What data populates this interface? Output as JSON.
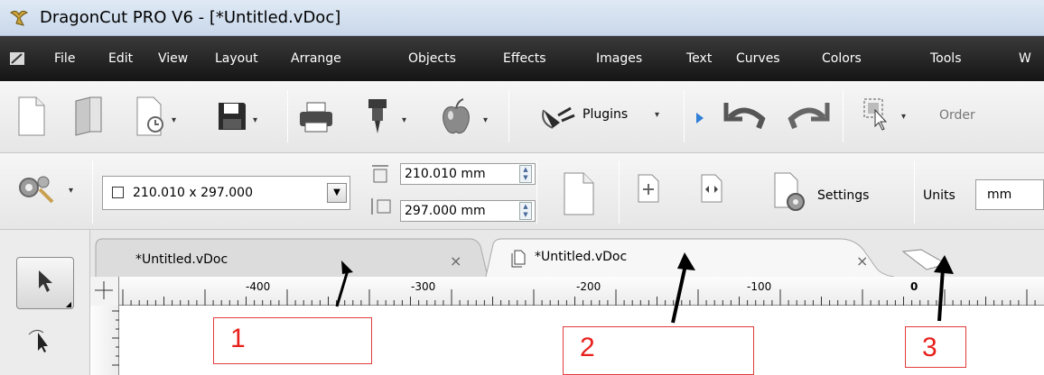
{
  "window": {
    "title": "DragonCut PRO V6 - [*Untitled.vDoc]",
    "app_icon": "dragon-app-icon"
  },
  "menu": {
    "items": [
      "File",
      "Edit",
      "View",
      "Layout",
      "Arrange",
      "Objects",
      "Effects",
      "Images",
      "Text",
      "Curves",
      "Colors",
      "Tools",
      "W"
    ]
  },
  "toolbar_main": {
    "icons": [
      "new-document-icon",
      "open-folder-icon",
      "recent-files-icon",
      "save-icon",
      "print-icon",
      "cutter-icon",
      "apple-icon",
      "plugins-icon",
      "play-icon",
      "undo-icon",
      "redo-icon",
      "select-tool-icon"
    ],
    "plugins_label": "Plugins",
    "order_label": "Order"
  },
  "toolbar_page": {
    "page_size": "210.010 x 297.000",
    "width_value": "210.010 mm",
    "height_value": "297.000 mm",
    "settings_label": "Settings",
    "units_label": "Units",
    "units_value": "mm"
  },
  "tabs": [
    {
      "label": "*Untitled.vDoc",
      "close": "×"
    },
    {
      "label": "*Untitled.vDoc",
      "close": "×"
    }
  ],
  "ruler": {
    "labels": [
      "-400",
      "-300",
      "-200",
      "-100",
      "0"
    ]
  },
  "annotations": [
    {
      "number": "1"
    },
    {
      "number": "2"
    },
    {
      "number": "3"
    }
  ],
  "colors": {
    "annotation": "#e23b3b",
    "menubar": "#1c1c1c",
    "titlebar": "#d4e1f1"
  }
}
